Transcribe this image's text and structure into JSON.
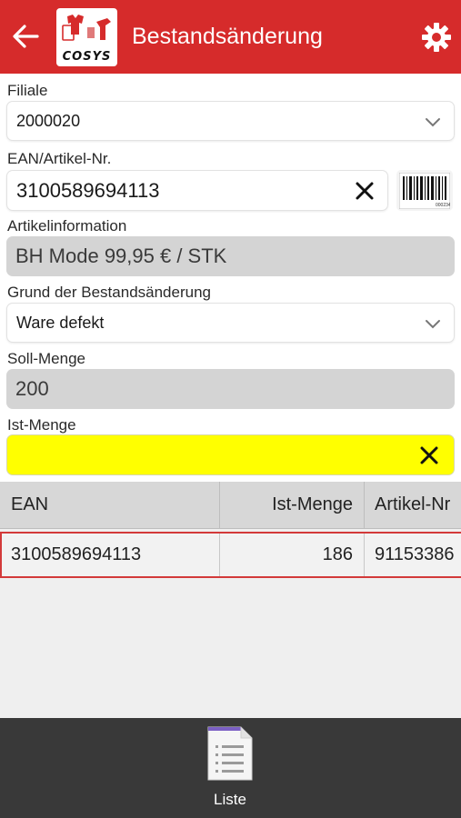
{
  "header": {
    "title": "Bestandsänderung",
    "logo_text": "COSYS",
    "accent_color": "#d62b2b",
    "back_icon": "arrow-left-icon",
    "settings_icon": "gear-icon"
  },
  "form": {
    "filiale": {
      "label": "Filiale",
      "value": "2000020"
    },
    "ean": {
      "label": "EAN/Artikel-Nr.",
      "value": "3100589694113",
      "barcode_caption": "000234"
    },
    "artikelinfo": {
      "label": "Artikelinformation",
      "value": "BH Mode 99,95 € / STK"
    },
    "grund": {
      "label": "Grund der Bestandsänderung",
      "value": "Ware defekt"
    },
    "soll_menge": {
      "label": "Soll-Menge",
      "value": "200"
    },
    "ist_menge": {
      "label": "Ist-Menge",
      "value": "",
      "highlight_color": "#ffff00"
    }
  },
  "table": {
    "columns": [
      "EAN",
      "Ist-Menge",
      "Artikel-Nr"
    ],
    "rows": [
      [
        "3100589694113",
        "186",
        "91153386"
      ]
    ]
  },
  "bottom_bar": {
    "tabs": [
      {
        "label": "Liste",
        "icon": "list-document-icon"
      }
    ]
  }
}
